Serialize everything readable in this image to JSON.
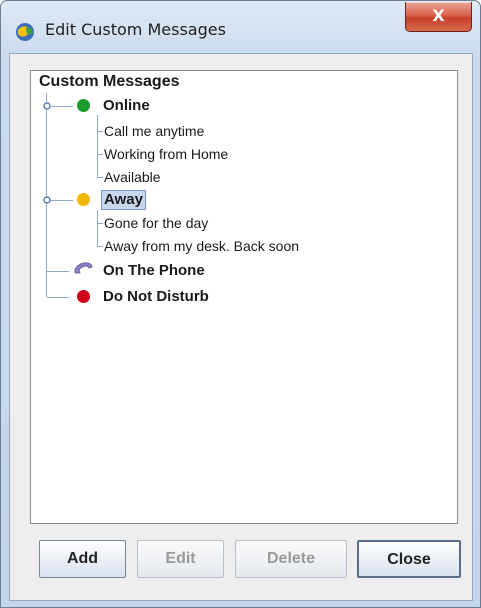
{
  "window": {
    "title": "Edit Custom Messages",
    "close_glyph": "X"
  },
  "tree": {
    "root_label": "Custom Messages",
    "groups": [
      {
        "label": "Online",
        "status_color": "#1a9c2a",
        "icon": "green-status-dot",
        "children": [
          "Call me anytime",
          "Working from Home",
          "Available"
        ]
      },
      {
        "label": "Away",
        "status_color": "#f2b705",
        "icon": "yellow-status-dot",
        "selected": true,
        "children": [
          "Gone for the day",
          "Away from my desk. Back soon"
        ]
      },
      {
        "label": "On The Phone",
        "icon": "phone-icon",
        "children": []
      },
      {
        "label": "Do Not Disturb",
        "status_color": "#d0021b",
        "icon": "red-status-dot",
        "children": []
      }
    ]
  },
  "buttons": {
    "add": "Add",
    "edit": "Edit",
    "delete": "Delete",
    "close": "Close"
  }
}
